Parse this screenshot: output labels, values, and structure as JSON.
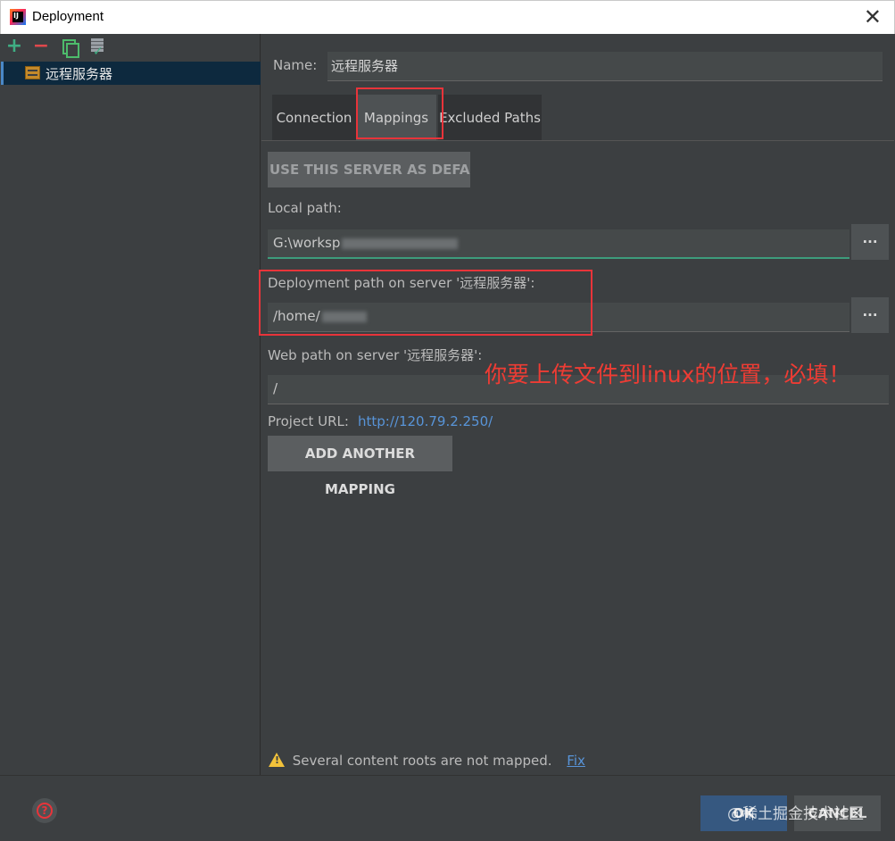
{
  "window": {
    "title": "Deployment",
    "app_icon_text": "IJ",
    "close_symbol": "✕"
  },
  "toolbar": {
    "add_symbol": "+",
    "remove_symbol": "−"
  },
  "servers": [
    {
      "label": "远程服务器"
    }
  ],
  "form": {
    "name_label": "Name:",
    "name_value": "远程服务器",
    "tabs": [
      {
        "label": "Connection"
      },
      {
        "label": "Mappings"
      },
      {
        "label": "Excluded Paths"
      }
    ],
    "use_default_label": "USE THIS SERVER AS DEFAULT",
    "local_path_label": "Local path:",
    "local_path_value": "G:\\worksp",
    "deployment_path_label": "Deployment path on server '远程服务器':",
    "deployment_path_value": "/home/",
    "web_path_label": "Web path on server '远程服务器':",
    "web_path_value": "/",
    "browse_label": "...",
    "project_url_label": "Project URL:",
    "project_url_value": "http://120.79.2.250/",
    "add_mapping_label": "ADD ANOTHER MAPPING",
    "warning_text": "Several content roots are not mapped.",
    "fix_label": "Fix"
  },
  "annotation_text": "你要上传文件到linux的位置，必填！",
  "footer": {
    "help_symbol": "?",
    "ok_label": "OK",
    "cancel_label": "CANCEL",
    "watermark": "@稀土掘金技术社区"
  },
  "colors": {
    "background": "#3c3f41",
    "annotation": "#ee3c34",
    "link": "#5894d8",
    "selection": "#0d293e",
    "ok_button": "#365880"
  }
}
